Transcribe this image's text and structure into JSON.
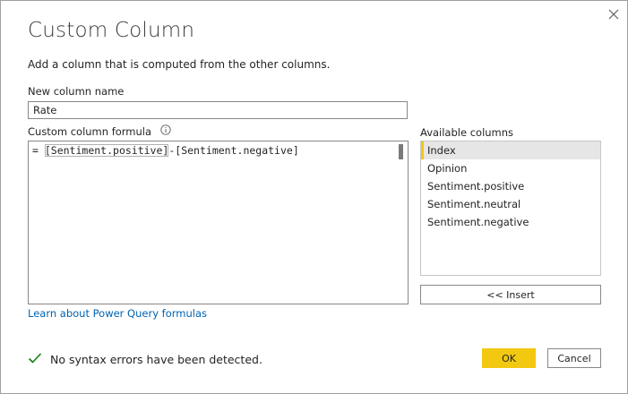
{
  "dialog": {
    "title": "Custom Column",
    "subtitle": "Add a column that is computed from the other columns."
  },
  "name_field": {
    "label": "New column name",
    "value": "Rate"
  },
  "formula": {
    "label": "Custom column formula",
    "prefix": "= ",
    "token1": "[Sentiment.positive]",
    "operator": "-",
    "token2": "[Sentiment.negative]"
  },
  "available": {
    "label": "Available columns",
    "items": [
      "Index",
      "Opinion",
      "Sentiment.positive",
      "Sentiment.neutral",
      "Sentiment.negative"
    ],
    "selected": "Index"
  },
  "buttons": {
    "insert": "<< Insert",
    "ok": "OK",
    "cancel": "Cancel"
  },
  "link": {
    "learn": "Learn about Power Query formulas"
  },
  "status": {
    "message": "No syntax errors have been detected."
  },
  "icons": {
    "close": "close-icon",
    "info": "info-icon",
    "check": "check-icon"
  },
  "colors": {
    "accent": "#f2c811",
    "link": "#0063b1",
    "success": "#107c10"
  }
}
